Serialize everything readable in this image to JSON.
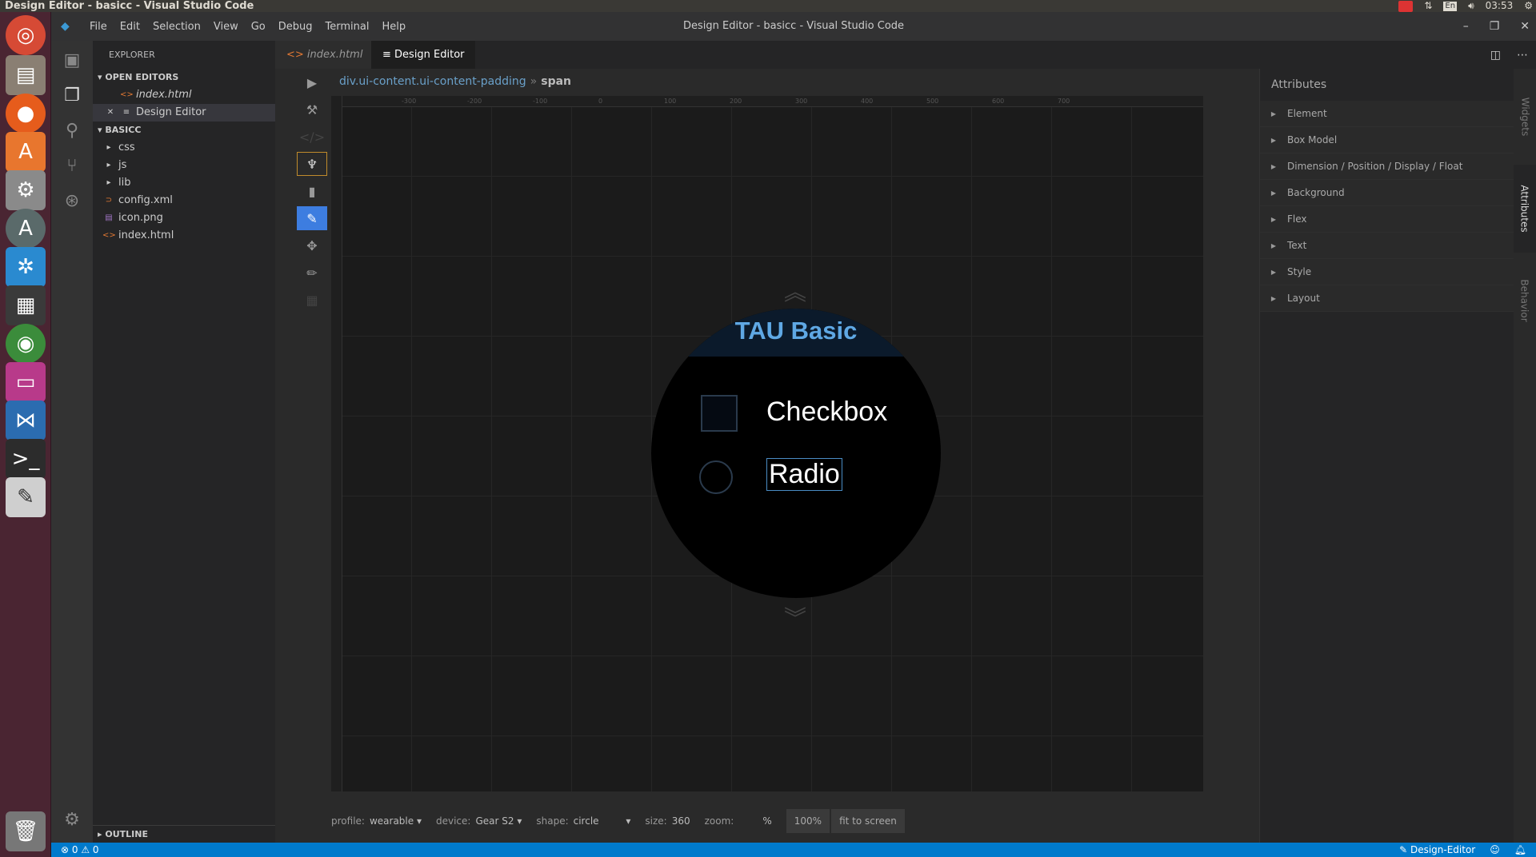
{
  "os": {
    "window_title": "Design Editor - basicc - Visual Studio Code",
    "clock": "03:53",
    "lang": "En"
  },
  "launcher": [
    "ubuntu-icon",
    "files-icon",
    "firefox-icon",
    "software-center-icon",
    "settings-icon",
    "updater-icon",
    "pinwheel-icon",
    "video-icon",
    "chrome-icon",
    "app-icon",
    "vscode-icon",
    "terminal-icon",
    "text-editor-icon",
    "trash-icon"
  ],
  "menu": [
    "File",
    "Edit",
    "Selection",
    "View",
    "Go",
    "Debug",
    "Terminal",
    "Help"
  ],
  "title": "Design Editor - basicc - Visual Studio Code",
  "sidebar": {
    "title": "EXPLORER",
    "open_editors": "OPEN EDITORS",
    "open_items": [
      "index.html",
      "Design Editor"
    ],
    "project": "BASICC",
    "tree": [
      "css",
      "js",
      "lib",
      "config.xml",
      "icon.png",
      "index.html"
    ],
    "outline": "OUTLINE"
  },
  "tabs": [
    "index.html",
    "Design Editor"
  ],
  "breadcrumb": [
    "div.ui-content.ui-content-padding",
    "span"
  ],
  "ruler_labels": [
    "-300",
    "-200",
    "-100",
    "0",
    "100",
    "200",
    "300",
    "400",
    "500",
    "600",
    "700"
  ],
  "watch": {
    "title": "TAU Basic",
    "checkbox_label": "Checkbox",
    "radio_label": "Radio"
  },
  "status_row": {
    "profile_key": "profile:",
    "profile_val": "wearable",
    "device_key": "device:",
    "device_val": "Gear S2",
    "shape_key": "shape:",
    "shape_val": "circle",
    "size_key": "size:",
    "size_val": "360",
    "zoom_key": "zoom:",
    "zoom_unit": "%",
    "zoom_btn": "100%",
    "fit_btn": "fit to screen"
  },
  "attributes": {
    "title": "Attributes",
    "items": [
      "Element",
      "Box Model",
      "Dimension / Position / Display / Float",
      "Background",
      "Flex",
      "Text",
      "Style",
      "Layout"
    ]
  },
  "right_tabs": [
    "Widgets",
    "Attributes",
    "Behavior"
  ],
  "statusbar": {
    "errors": "⊗ 0  ⚠ 0",
    "mode": "✎ Design-Editor"
  }
}
